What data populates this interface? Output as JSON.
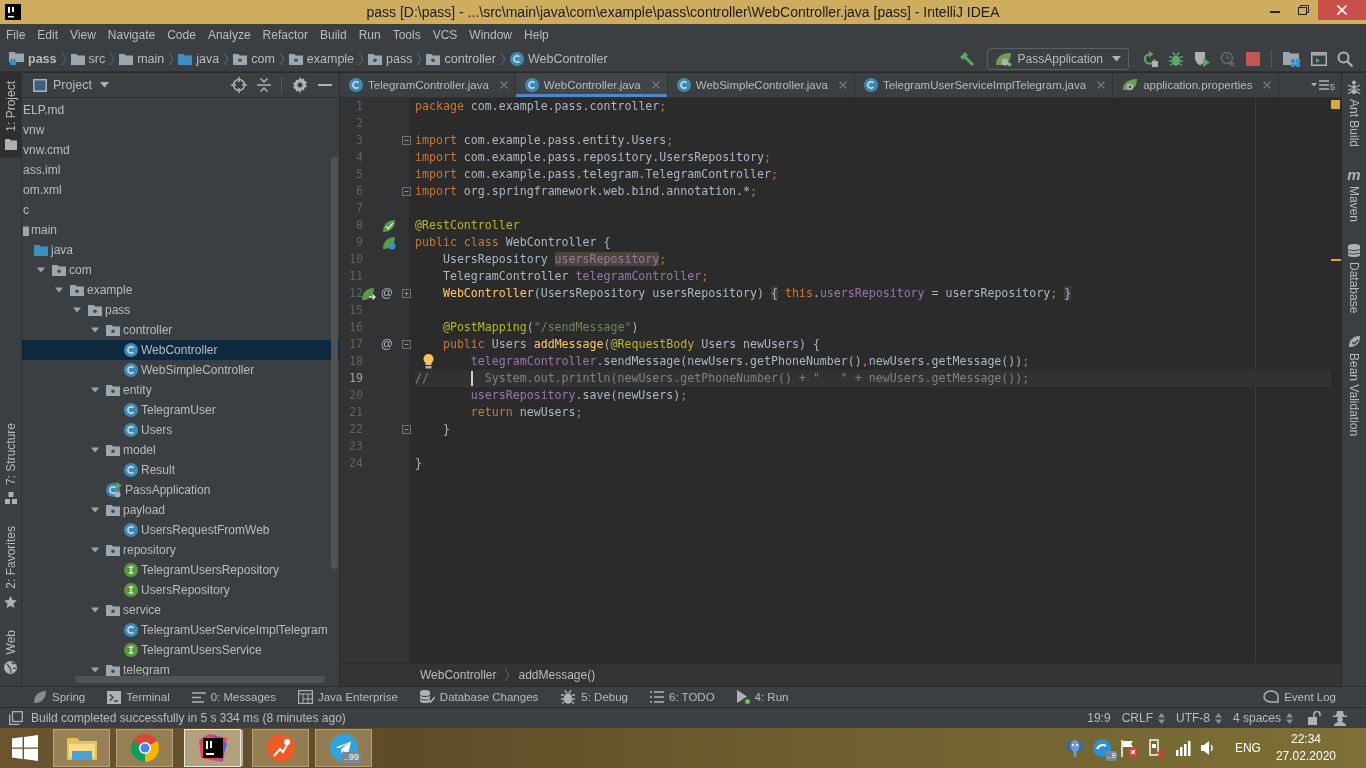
{
  "window": {
    "title": "pass [D:\\pass] - ...\\src\\main\\java\\com\\example\\pass\\controller\\WebController.java [pass] - IntelliJ IDEA"
  },
  "menu": [
    "File",
    "Edit",
    "View",
    "Navigate",
    "Code",
    "Analyze",
    "Refactor",
    "Build",
    "Run",
    "Tools",
    "VCS",
    "Window",
    "Help"
  ],
  "navbar": {
    "crumbs": [
      {
        "label": "pass",
        "kind": "project"
      },
      {
        "label": "src",
        "kind": "folder"
      },
      {
        "label": "main",
        "kind": "folder"
      },
      {
        "label": "java",
        "kind": "source-folder"
      },
      {
        "label": "com",
        "kind": "package"
      },
      {
        "label": "example",
        "kind": "package"
      },
      {
        "label": "pass",
        "kind": "package"
      },
      {
        "label": "controller",
        "kind": "package"
      },
      {
        "label": "WebController",
        "kind": "class"
      }
    ],
    "actions": [
      {
        "kind": "build",
        "disabled": false
      },
      {
        "kind": "run-config",
        "label": "PassApplication",
        "disabled": false
      },
      {
        "kind": "rerun",
        "disabled": false
      },
      {
        "kind": "debug",
        "disabled": false
      },
      {
        "kind": "coverage",
        "disabled": false
      },
      {
        "kind": "profile",
        "disabled": true
      },
      {
        "kind": "stop",
        "disabled": false
      },
      {
        "kind": "project-structure",
        "disabled": false
      },
      {
        "kind": "terminal",
        "disabled": false
      },
      {
        "kind": "search",
        "disabled": false
      }
    ]
  },
  "left_strip": {
    "top": [
      {
        "label": "1: Project",
        "kind": "project",
        "selected": true
      }
    ],
    "bottom": [
      {
        "label": "7: Structure",
        "kind": "structure",
        "selected": false
      },
      {
        "label": "2: Favorites",
        "kind": "favorites",
        "selected": false
      },
      {
        "label": "Web",
        "kind": "web",
        "selected": false
      }
    ]
  },
  "project": {
    "title": "Project",
    "tree": [
      {
        "label": "ELP.md",
        "selected": false
      },
      {
        "label": "vnw",
        "selected": false
      },
      {
        "label": "vnw.cmd",
        "selected": false
      },
      {
        "label": "ass.iml",
        "selected": false
      },
      {
        "label": "om.xml",
        "selected": false
      },
      {
        "label": "c",
        "selected": false,
        "children": [
          {
            "label": "main",
            "kind": "folder",
            "selected": false,
            "children": [
              {
                "label": "java",
                "kind": "source-folder",
                "selected": false,
                "children": [
                  {
                    "label": "com",
                    "kind": "package",
                    "expanded": true,
                    "selected": false,
                    "children": [
                      {
                        "label": "example",
                        "kind": "package",
                        "expanded": true,
                        "selected": false,
                        "children": [
                          {
                            "label": "pass",
                            "kind": "package",
                            "expanded": true,
                            "selected": false,
                            "children": [
                              {
                                "label": "controller",
                                "kind": "package",
                                "expanded": true,
                                "selected": false,
                                "children": [
                                  {
                                    "label": "WebController",
                                    "kind": "class",
                                    "selected": true
                                  },
                                  {
                                    "label": "WebSimpleController",
                                    "kind": "class",
                                    "selected": false
                                  }
                                ]
                              },
                              {
                                "label": "entity",
                                "kind": "package",
                                "expanded": true,
                                "selected": false,
                                "children": [
                                  {
                                    "label": "TelegramUser",
                                    "kind": "class",
                                    "selected": false
                                  },
                                  {
                                    "label": "Users",
                                    "kind": "class",
                                    "selected": false
                                  }
                                ]
                              },
                              {
                                "label": "model",
                                "kind": "package",
                                "expanded": true,
                                "selected": false,
                                "children": [
                                  {
                                    "label": "Result",
                                    "kind": "class",
                                    "selected": false
                                  }
                                ]
                              },
                              {
                                "label": "PassApplication",
                                "kind": "application",
                                "selected": false
                              },
                              {
                                "label": "payload",
                                "kind": "package",
                                "expanded": true,
                                "selected": false,
                                "children": [
                                  {
                                    "label": "UsersRequestFromWeb",
                                    "kind": "class",
                                    "selected": false
                                  }
                                ]
                              },
                              {
                                "label": "repository",
                                "kind": "package",
                                "expanded": true,
                                "selected": false,
                                "children": [
                                  {
                                    "label": "TelegramUsersRepository",
                                    "kind": "interface",
                                    "selected": false
                                  },
                                  {
                                    "label": "UsersRepository",
                                    "kind": "interface",
                                    "selected": false
                                  }
                                ]
                              },
                              {
                                "label": "service",
                                "kind": "package",
                                "expanded": true,
                                "selected": false,
                                "children": [
                                  {
                                    "label": "TelegramUserServiceImplTelegram",
                                    "kind": "class",
                                    "selected": false
                                  },
                                  {
                                    "label": "TelegramUsersService",
                                    "kind": "interface",
                                    "selected": false
                                  }
                                ]
                              },
                              {
                                "label": "telegram",
                                "kind": "package",
                                "expanded": true,
                                "selected": false
                              }
                            ]
                          }
                        ]
                      }
                    ]
                  }
                ]
              }
            ]
          }
        ]
      }
    ]
  },
  "editor": {
    "tabs": [
      {
        "label": "TelegramController.java",
        "kind": "class",
        "selected": false
      },
      {
        "label": "WebController.java",
        "kind": "class",
        "selected": true
      },
      {
        "label": "WebSimpleController.java",
        "kind": "class",
        "selected": false
      },
      {
        "label": "TelegramUserServiceImplTelegram.java",
        "kind": "class",
        "selected": false
      },
      {
        "label": "application.properties",
        "kind": "properties",
        "selected": false
      }
    ],
    "hidden_tabs": "5",
    "inspection": {
      "kind": "warning"
    },
    "lines": [
      {
        "number": "1",
        "current": false,
        "warning": false,
        "bulb": false,
        "tokens": [
          {
            "kind": "keyword",
            "text": "package"
          },
          {
            "kind": "plain",
            "text": " com.example.pass.controller"
          },
          {
            "kind": "punct",
            "text": ";"
          }
        ]
      },
      {
        "number": "2",
        "current": false,
        "warning": false,
        "bulb": false
      },
      {
        "number": "3",
        "current": false,
        "warning": false,
        "bulb": false,
        "fold": {
          "kind": "start"
        },
        "tokens": [
          {
            "kind": "keyword",
            "text": "import"
          },
          {
            "kind": "plain",
            "text": " com.example.pass.entity.Users"
          },
          {
            "kind": "punct",
            "text": ";"
          }
        ]
      },
      {
        "number": "4",
        "current": false,
        "warning": false,
        "bulb": false,
        "tokens": [
          {
            "kind": "keyword",
            "text": "import"
          },
          {
            "kind": "plain",
            "text": " com.example.pass.repository.UsersRepository"
          },
          {
            "kind": "punct",
            "text": ";"
          }
        ]
      },
      {
        "number": "5",
        "current": false,
        "warning": false,
        "bulb": false,
        "tokens": [
          {
            "kind": "keyword",
            "text": "import"
          },
          {
            "kind": "plain",
            "text": " com.example.pass.telegram.TelegramController"
          },
          {
            "kind": "punct",
            "text": ";"
          }
        ]
      },
      {
        "number": "6",
        "current": false,
        "warning": false,
        "bulb": false,
        "fold": {
          "kind": "end"
        },
        "tokens": [
          {
            "kind": "keyword",
            "text": "import"
          },
          {
            "kind": "plain",
            "text": " org.springframework.web.bind.annotation.*"
          },
          {
            "kind": "punct",
            "text": ";"
          }
        ]
      },
      {
        "number": "7",
        "current": false,
        "warning": false,
        "bulb": false
      },
      {
        "number": "8",
        "current": false,
        "warning": false,
        "bulb": false,
        "gutter": [
          {
            "kind": "bean"
          }
        ],
        "tokens": [
          {
            "kind": "annotation",
            "text": "@RestController"
          }
        ]
      },
      {
        "number": "9",
        "current": false,
        "warning": false,
        "bulb": false,
        "gutter": [
          {
            "kind": "bean-class"
          }
        ],
        "tokens": [
          {
            "kind": "keyword",
            "text": "public class"
          },
          {
            "kind": "plain",
            "text": " WebController {"
          }
        ]
      },
      {
        "number": "10",
        "current": false,
        "warning": true,
        "bulb": false,
        "tokens": [
          {
            "kind": "plain",
            "text": "    UsersRepository "
          },
          {
            "kind": "usage",
            "text": "usersRepository"
          },
          {
            "kind": "punct",
            "text": ";"
          }
        ]
      },
      {
        "number": "11",
        "current": false,
        "warning": false,
        "bulb": false,
        "tokens": [
          {
            "kind": "plain",
            "text": "    TelegramController "
          },
          {
            "kind": "field",
            "text": "telegramController"
          },
          {
            "kind": "punct",
            "text": ";"
          }
        ]
      },
      {
        "number": "12",
        "current": false,
        "warning": false,
        "bulb": false,
        "gutter": [
          {
            "kind": "bean-injection"
          },
          {
            "kind": "marker",
            "text": "@"
          }
        ],
        "fold": {
          "kind": "collapsed"
        },
        "tokens": [
          {
            "kind": "method",
            "text": "    WebController"
          },
          {
            "kind": "plain",
            "text": "(UsersRepository usersRepository) "
          },
          {
            "kind": "fold",
            "text": "{"
          },
          {
            "kind": "keyword",
            "text": " this"
          },
          {
            "kind": "plain",
            "text": "."
          },
          {
            "kind": "field",
            "text": "usersRepository"
          },
          {
            "kind": "plain",
            "text": " = usersRepository"
          },
          {
            "kind": "punct",
            "text": "; "
          },
          {
            "kind": "fold",
            "text": "}"
          }
        ]
      },
      {
        "number": "15",
        "current": false,
        "warning": false,
        "bulb": false
      },
      {
        "number": "16",
        "current": false,
        "warning": false,
        "bulb": false,
        "tokens": [
          {
            "kind": "annotation",
            "text": "    @PostMapping"
          },
          {
            "kind": "plain",
            "text": "("
          },
          {
            "kind": "string",
            "text": "\"/sendMessage\""
          },
          {
            "kind": "plain",
            "text": ")"
          }
        ]
      },
      {
        "number": "17",
        "current": false,
        "warning": false,
        "bulb": false,
        "gutter": [
          {
            "kind": "marker",
            "text": "@"
          }
        ],
        "fold": {
          "kind": "start"
        },
        "tokens": [
          {
            "kind": "keyword",
            "text": "    public"
          },
          {
            "kind": "plain",
            "text": " Users "
          },
          {
            "kind": "method",
            "text": "addMessage"
          },
          {
            "kind": "plain",
            "text": "("
          },
          {
            "kind": "annotation",
            "text": "@RequestBody"
          },
          {
            "kind": "plain",
            "text": " Users newUsers) {"
          }
        ]
      },
      {
        "number": "18",
        "current": false,
        "warning": false,
        "bulb": true,
        "tokens": [
          {
            "kind": "field",
            "text": "        telegramController"
          },
          {
            "kind": "plain",
            "text": ".sendMessage(newUsers.getPhoneNumber()"
          },
          {
            "kind": "punct",
            "text": ","
          },
          {
            "kind": "plain",
            "text": "newUsers.getMessage())"
          },
          {
            "kind": "punct",
            "text": ";"
          }
        ]
      },
      {
        "number": "19",
        "current": true,
        "warning": false,
        "bulb": false,
        "tokens": [
          {
            "kind": "comment",
            "text": "//      "
          },
          {
            "kind": "comment",
            "text": "  System.out.println(newUsers.getPhoneNumber() + \"   \" + newUsers.getMessage());"
          }
        ]
      },
      {
        "number": "20",
        "current": false,
        "warning": false,
        "bulb": false,
        "tokens": [
          {
            "kind": "field",
            "text": "        usersRepository"
          },
          {
            "kind": "plain",
            "text": ".save(newUsers)"
          },
          {
            "kind": "punct",
            "text": ";"
          }
        ]
      },
      {
        "number": "21",
        "current": false,
        "warning": false,
        "bulb": false,
        "tokens": [
          {
            "kind": "keyword",
            "text": "        return"
          },
          {
            "kind": "plain",
            "text": " newUsers"
          },
          {
            "kind": "punct",
            "text": ";"
          }
        ]
      },
      {
        "number": "22",
        "current": false,
        "warning": false,
        "bulb": false,
        "fold": {
          "kind": "end"
        },
        "tokens": [
          {
            "kind": "plain",
            "text": "    }"
          }
        ]
      },
      {
        "number": "23",
        "current": false,
        "warning": false,
        "bulb": false
      },
      {
        "number": "24",
        "current": false,
        "warning": false,
        "bulb": false,
        "tokens": [
          {
            "kind": "plain",
            "text": "}"
          }
        ]
      }
    ],
    "breadcrumbs": [
      "WebController",
      "addMessage()"
    ]
  },
  "right_strip": [
    {
      "label": "Ant Build",
      "kind": "ant",
      "selected": false
    },
    {
      "label": "Maven",
      "kind": "maven",
      "glyph": "m",
      "selected": false
    },
    {
      "label": "Database",
      "kind": "database",
      "selected": false
    },
    {
      "label": "Bean Validation",
      "kind": "bean-validation",
      "selected": false
    }
  ],
  "tool_window_bar": {
    "left": [
      {
        "label": "Spring",
        "kind": "spring",
        "selected": false
      },
      {
        "label": "Terminal",
        "kind": "terminal",
        "selected": false
      },
      {
        "label": "0: Messages",
        "kind": "messages",
        "selected": false
      },
      {
        "label": "Java Enterprise",
        "kind": "java-enterprise",
        "selected": false
      },
      {
        "label": "Database Changes",
        "kind": "database-changes",
        "selected": false
      },
      {
        "label": "5: Debug",
        "kind": "debug",
        "selected": false
      },
      {
        "label": "6: TODO",
        "kind": "todo",
        "selected": false
      },
      {
        "label": "4: Run",
        "kind": "run",
        "selected": false
      }
    ],
    "right": [
      {
        "label": "Event Log",
        "kind": "event-log",
        "selected": false
      }
    ]
  },
  "status_bar": {
    "message": "Build completed successfully in 5 s 334 ms (8 minutes ago)",
    "items": [
      {
        "label": "19:9",
        "kind": "position"
      },
      {
        "label": "CRLF",
        "kind": "selector"
      },
      {
        "label": "UTF-8",
        "kind": "selector"
      },
      {
        "label": "4 spaces",
        "kind": "selector"
      }
    ]
  },
  "taskbar": {
    "apps": [
      {
        "kind": "files",
        "active": false
      },
      {
        "kind": "browser",
        "active": false
      },
      {
        "kind": "ide",
        "active": true
      },
      {
        "kind": "api-client",
        "active": false
      },
      {
        "kind": "messenger",
        "active": false,
        "badge": "..99"
      }
    ],
    "tray": [
      {
        "kind": "database"
      },
      {
        "kind": "updates",
        "badge": "..9"
      },
      {
        "kind": "flag-alert"
      },
      {
        "kind": "power-alert"
      },
      {
        "kind": "signal"
      },
      {
        "kind": "volume"
      }
    ],
    "language": "ENG",
    "time": "22:34",
    "date": "27.02.2020"
  }
}
